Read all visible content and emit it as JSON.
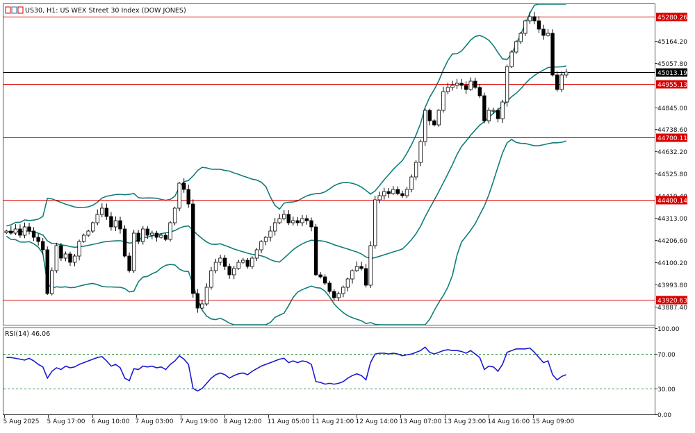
{
  "window": {
    "title": "US30, H1: US WEX Street 30 Index (DOW JONES)",
    "title_icon": "chart-window-icon"
  },
  "colors": {
    "candle": "#000000",
    "bollinger": "#117d79",
    "level_line": "#d90000",
    "level_label_bg": "#d90000",
    "current_line": "#000000",
    "current_label_bg": "#000000",
    "rsi_line": "#1d1ad0",
    "rsi_level": "#2c8a3a"
  },
  "chart_data": [
    {
      "type": "candlestick",
      "title": "US30, H1: US WEX Street 30 Index (DOW JONES)",
      "symbol": "US30",
      "timeframe": "H1",
      "ylim": [
        43800,
        45340
      ],
      "y_ticks": [
        "45164.20",
        "45057.80",
        "44845.00",
        "44738.60",
        "44632.20",
        "44525.80",
        "44419.40",
        "44313.00",
        "44206.60",
        "44100.20",
        "43993.80",
        "43887.40"
      ],
      "y_tick_values": [
        45164.2,
        45057.8,
        44845.0,
        44738.6,
        44632.2,
        44525.8,
        44419.4,
        44313.0,
        44206.6,
        44100.2,
        43993.8,
        43887.4
      ],
      "x_ticks": [
        "5 Aug 2025",
        "5 Aug 17:00",
        "6 Aug 10:00",
        "7 Aug 03:00",
        "7 Aug 19:00",
        "8 Aug 12:00",
        "11 Aug 05:00",
        "11 Aug 21:00",
        "12 Aug 14:00",
        "13 Aug 07:00",
        "13 Aug 23:00",
        "14 Aug 16:00",
        "15 Aug 09:00"
      ],
      "horizontal_levels": [
        {
          "value": 45280.26,
          "label": "45280.26"
        },
        {
          "value": 44955.13,
          "label": "44955.13"
        },
        {
          "value": 44700.11,
          "label": "44700.11"
        },
        {
          "value": 44400.14,
          "label": "44400.14"
        },
        {
          "value": 43920.63,
          "label": "43920.63"
        }
      ],
      "current_price": {
        "value": 45013.19,
        "label": "45013.19"
      },
      "grid": false,
      "indicators": [
        "Bollinger Bands"
      ],
      "closes": [
        44250,
        44240,
        44260,
        44230,
        44270,
        44250,
        44220,
        44200,
        44160,
        43950,
        44060,
        44180,
        44120,
        44140,
        44100,
        44130,
        44200,
        44230,
        44250,
        44290,
        44330,
        44360,
        44320,
        44270,
        44300,
        44260,
        44130,
        44060,
        44240,
        44200,
        44260,
        44230,
        44240,
        44220,
        44230,
        44210,
        44290,
        44360,
        44480,
        44450,
        44380,
        43950,
        43880,
        43900,
        43980,
        44060,
        44100,
        44120,
        44080,
        44040,
        44070,
        44100,
        44110,
        44080,
        44120,
        44160,
        44200,
        44220,
        44250,
        44290,
        44310,
        44330,
        44290,
        44300,
        44290,
        44310,
        44300,
        44270,
        44040,
        44030,
        44000,
        43960,
        43930,
        43950,
        43980,
        44020,
        44060,
        44080,
        44070,
        43990,
        44180,
        44400,
        44420,
        44440,
        44430,
        44450,
        44430,
        44420,
        44450,
        44510,
        44580,
        44680,
        44830,
        44780,
        44760,
        44830,
        44920,
        44940,
        44950,
        44960,
        44950,
        44930,
        44970,
        44940,
        44900,
        44780,
        44830,
        44830,
        44790,
        44870,
        45040,
        45110,
        45160,
        45200,
        45260,
        45280,
        45260,
        45220,
        45190,
        45200,
        45000,
        44930,
        45000,
        45013.19
      ],
      "rsi_panel": {
        "label": "RSI(14) 46.06",
        "period": 14,
        "current": 46.06,
        "ylim": [
          0,
          100
        ],
        "ticks": [
          "100.00",
          "70.00",
          "30.00",
          "0.00"
        ],
        "tick_values": [
          100,
          70,
          30,
          0
        ],
        "levels": [
          70,
          30
        ],
        "values": [
          66,
          66,
          65,
          64,
          63,
          65,
          62,
          58,
          55,
          42,
          50,
          54,
          52,
          56,
          54,
          55,
          58,
          60,
          62,
          64,
          66,
          67,
          62,
          56,
          58,
          54,
          42,
          39,
          53,
          52,
          56,
          55,
          56,
          54,
          55,
          52,
          58,
          62,
          68,
          64,
          58,
          30,
          27,
          30,
          36,
          42,
          46,
          48,
          46,
          42,
          45,
          47,
          48,
          46,
          50,
          53,
          56,
          58,
          60,
          62,
          64,
          65,
          60,
          62,
          60,
          62,
          61,
          58,
          38,
          37,
          35,
          36,
          35,
          36,
          38,
          42,
          45,
          47,
          45,
          40,
          60,
          70,
          71,
          71,
          70,
          71,
          70,
          68,
          69,
          70,
          72,
          74,
          78,
          72,
          70,
          72,
          74,
          75,
          74,
          74,
          73,
          71,
          74,
          70,
          66,
          52,
          56,
          55,
          50,
          58,
          72,
          74,
          76,
          76,
          76,
          77,
          72,
          66,
          60,
          62,
          46,
          40,
          44,
          46
        ]
      }
    }
  ]
}
